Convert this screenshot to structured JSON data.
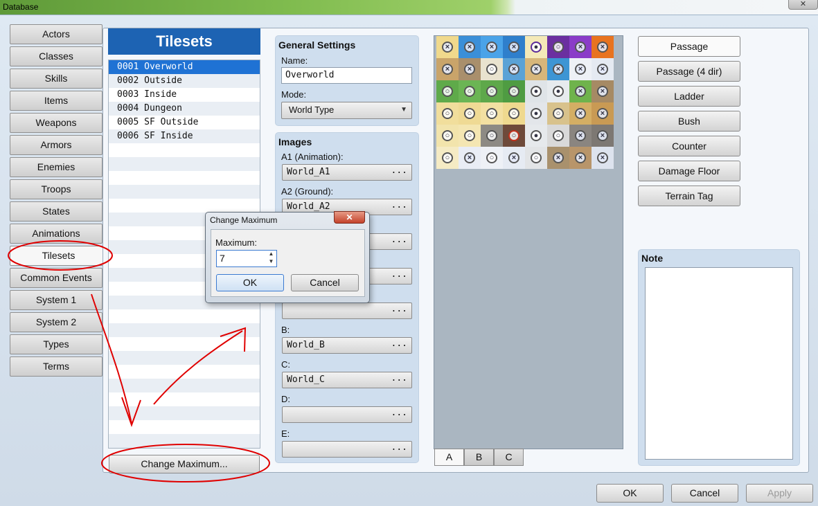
{
  "window": {
    "title": "Database",
    "close_glyph": "✕"
  },
  "nav": {
    "items": [
      "Actors",
      "Classes",
      "Skills",
      "Items",
      "Weapons",
      "Armors",
      "Enemies",
      "Troops",
      "States",
      "Animations",
      "Tilesets",
      "Common Events",
      "System 1",
      "System 2",
      "Types",
      "Terms"
    ],
    "active": "Tilesets"
  },
  "tilesets": {
    "header": "Tilesets",
    "items": [
      "0001 Overworld",
      "0002 Outside",
      "0003 Inside",
      "0004 Dungeon",
      "0005 SF Outside",
      "0006 SF Inside"
    ],
    "selected_index": 0,
    "change_max_label": "Change Maximum..."
  },
  "general": {
    "title": "General Settings",
    "name_label": "Name:",
    "name_value": "Overworld",
    "mode_label": "Mode:",
    "mode_value": "World Type"
  },
  "images": {
    "title": "Images",
    "a1_label": "A1 (Animation):",
    "a1_value": "World_A1",
    "a2_label": "A2 (Ground):",
    "a2_value": "World_A2",
    "b_label": "B:",
    "b_value": "World_B",
    "c_label": "C:",
    "c_value": "World_C",
    "d_label": "D:",
    "d_value": "",
    "e_label": "E:",
    "e_value": "",
    "dots": "..."
  },
  "palette_tabs": [
    "A",
    "B",
    "C"
  ],
  "mode_buttons": [
    "Passage",
    "Passage (4 dir)",
    "Ladder",
    "Bush",
    "Counter",
    "Damage Floor",
    "Terrain Tag"
  ],
  "note": {
    "title": "Note"
  },
  "footer": {
    "ok": "OK",
    "cancel": "Cancel",
    "apply": "Apply"
  },
  "dialog": {
    "title": "Change Maximum",
    "close_glyph": "✕",
    "max_label": "Maximum:",
    "max_value": "7",
    "ok": "OK",
    "cancel": "Cancel"
  },
  "colors": {
    "accent": "#1d63b3",
    "annotation": "#e00000",
    "selection": "#1f72d4"
  }
}
